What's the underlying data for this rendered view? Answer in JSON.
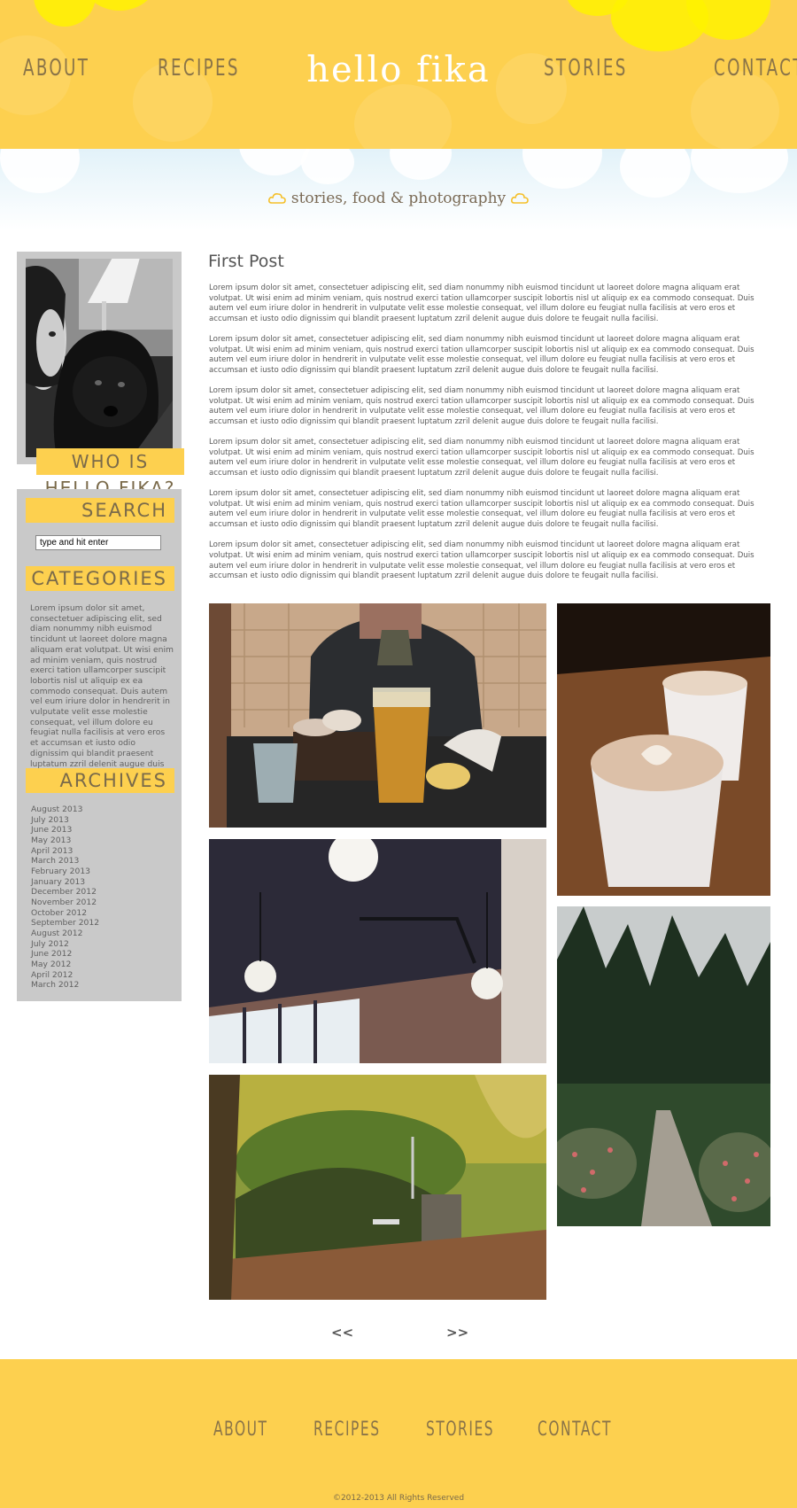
{
  "header": {
    "title": "hello fika",
    "nav": [
      "ABOUT",
      "RECIPES",
      "STORIES",
      "CONTACT"
    ]
  },
  "tagline": "stories, food & photography",
  "sidebar": {
    "about_label": "WHO IS HELLO FIKA?",
    "search_heading": "SEARCH",
    "search_value": "type and hit enter",
    "categories_heading": "CATEGORIES",
    "categories_text": "Lorem ipsum dolor sit amet, consectetuer adipiscing elit, sed diam nonummy nibh euismod tincidunt ut laoreet dolore magna aliquam erat volutpat. Ut wisi enim ad minim veniam, quis nostrud exerci tation ullamcorper suscipit lobortis nisl ut aliquip ex ea commodo consequat. Duis autem vel eum iriure dolor in hendrerit in vulputate velit esse molestie consequat, vel illum dolore eu feugiat nulla facilisis at vero eros et accumsan et iusto odio dignissim qui blandit praesent luptatum zzril delenit augue duis dolore.",
    "archives_heading": "ARCHIVES",
    "archives": [
      "August 2013",
      "July 2013",
      "June 2013",
      "May 2013",
      "April 2013",
      "March 2013",
      "February 2013",
      "January 2013",
      "December 2012",
      "November 2012",
      "October 2012",
      "September 2012",
      "August 2012",
      "July 2012",
      "June 2012",
      "May 2012",
      "April 2012",
      "March 2012"
    ]
  },
  "post": {
    "title": "First Post",
    "paragraphs": [
      "Lorem ipsum dolor sit amet, consectetuer adipiscing elit, sed diam nonummy nibh euismod tincidunt ut laoreet dolore magna aliquam erat volutpat. Ut wisi enim ad minim veniam, quis nostrud exerci tation ullamcorper suscipit lobortis nisl ut aliquip ex ea commodo consequat. Duis autem vel eum iriure dolor in hendrerit in vulputate velit esse molestie consequat, vel illum dolore eu feugiat nulla facilisis at vero eros et accumsan et iusto odio dignissim qui blandit praesent luptatum zzril delenit augue duis dolore te feugait nulla facilisi.",
      "Lorem ipsum dolor sit amet, consectetuer adipiscing elit, sed diam nonummy nibh euismod tincidunt ut laoreet dolore magna aliquam erat volutpat. Ut wisi enim ad minim veniam, quis nostrud exerci tation ullamcorper suscipit lobortis nisl ut aliquip ex ea commodo consequat. Duis autem vel eum iriure dolor in hendrerit in vulputate velit esse molestie consequat, vel illum dolore eu feugiat nulla facilisis at vero eros et accumsan et iusto odio dignissim qui blandit praesent luptatum zzril delenit augue duis dolore te feugait nulla facilisi.",
      "Lorem ipsum dolor sit amet, consectetuer adipiscing elit, sed diam nonummy nibh euismod tincidunt ut laoreet dolore magna aliquam erat volutpat. Ut wisi enim ad minim veniam, quis nostrud exerci tation ullamcorper suscipit lobortis nisl ut aliquip ex ea commodo consequat. Duis autem vel eum iriure dolor in hendrerit in vulputate velit esse molestie consequat, vel illum dolore eu feugiat nulla facilisis at vero eros et accumsan et iusto odio dignissim qui blandit praesent luptatum zzril delenit augue duis dolore te feugait nulla facilisi.",
      "Lorem ipsum dolor sit amet, consectetuer adipiscing elit, sed diam nonummy nibh euismod tincidunt ut laoreet dolore magna aliquam erat volutpat. Ut wisi enim ad minim veniam, quis nostrud exerci tation ullamcorper suscipit lobortis nisl ut aliquip ex ea commodo consequat. Duis autem vel eum iriure dolor in hendrerit in vulputate velit esse molestie consequat, vel illum dolore eu feugiat nulla facilisis at vero eros et accumsan et iusto odio dignissim qui blandit praesent luptatum zzril delenit augue duis dolore te feugait nulla facilisi.",
      "Lorem ipsum dolor sit amet, consectetuer adipiscing elit, sed diam nonummy nibh euismod tincidunt ut laoreet dolore magna aliquam erat volutpat. Ut wisi enim ad minim veniam, quis nostrud exerci tation ullamcorper suscipit lobortis nisl ut aliquip ex ea commodo consequat. Duis autem vel eum iriure dolor in hendrerit in vulputate velit esse molestie consequat, vel illum dolore eu feugiat nulla facilisis at vero eros et accumsan et iusto odio dignissim qui blandit praesent luptatum zzril delenit augue duis dolore te feugait nulla facilisi.",
      "Lorem ipsum dolor sit amet, consectetuer adipiscing elit, sed diam nonummy nibh euismod tincidunt ut laoreet dolore magna aliquam erat volutpat. Ut wisi enim ad minim veniam, quis nostrud exerci tation ullamcorper suscipit lobortis nisl ut aliquip ex ea commodo consequat. Duis autem vel eum iriure dolor in hendrerit in vulputate velit esse molestie consequat, vel illum dolore eu feugiat nulla facilisis at vero eros et accumsan et iusto odio dignissim qui blandit praesent luptatum zzril delenit augue duis dolore te feugait nulla facilisi."
    ]
  },
  "pager": {
    "prev": "<<",
    "next": ">>"
  },
  "footer": {
    "nav": [
      "ABOUT",
      "RECIPES",
      "STORIES",
      "CONTACT"
    ],
    "copyright": "©2012-2013 All Rights Reserved"
  },
  "colors": {
    "brand_yellow": "#fdd04f",
    "sidebar_gray": "#c9c9c9",
    "nav_text": "#8a7448"
  }
}
